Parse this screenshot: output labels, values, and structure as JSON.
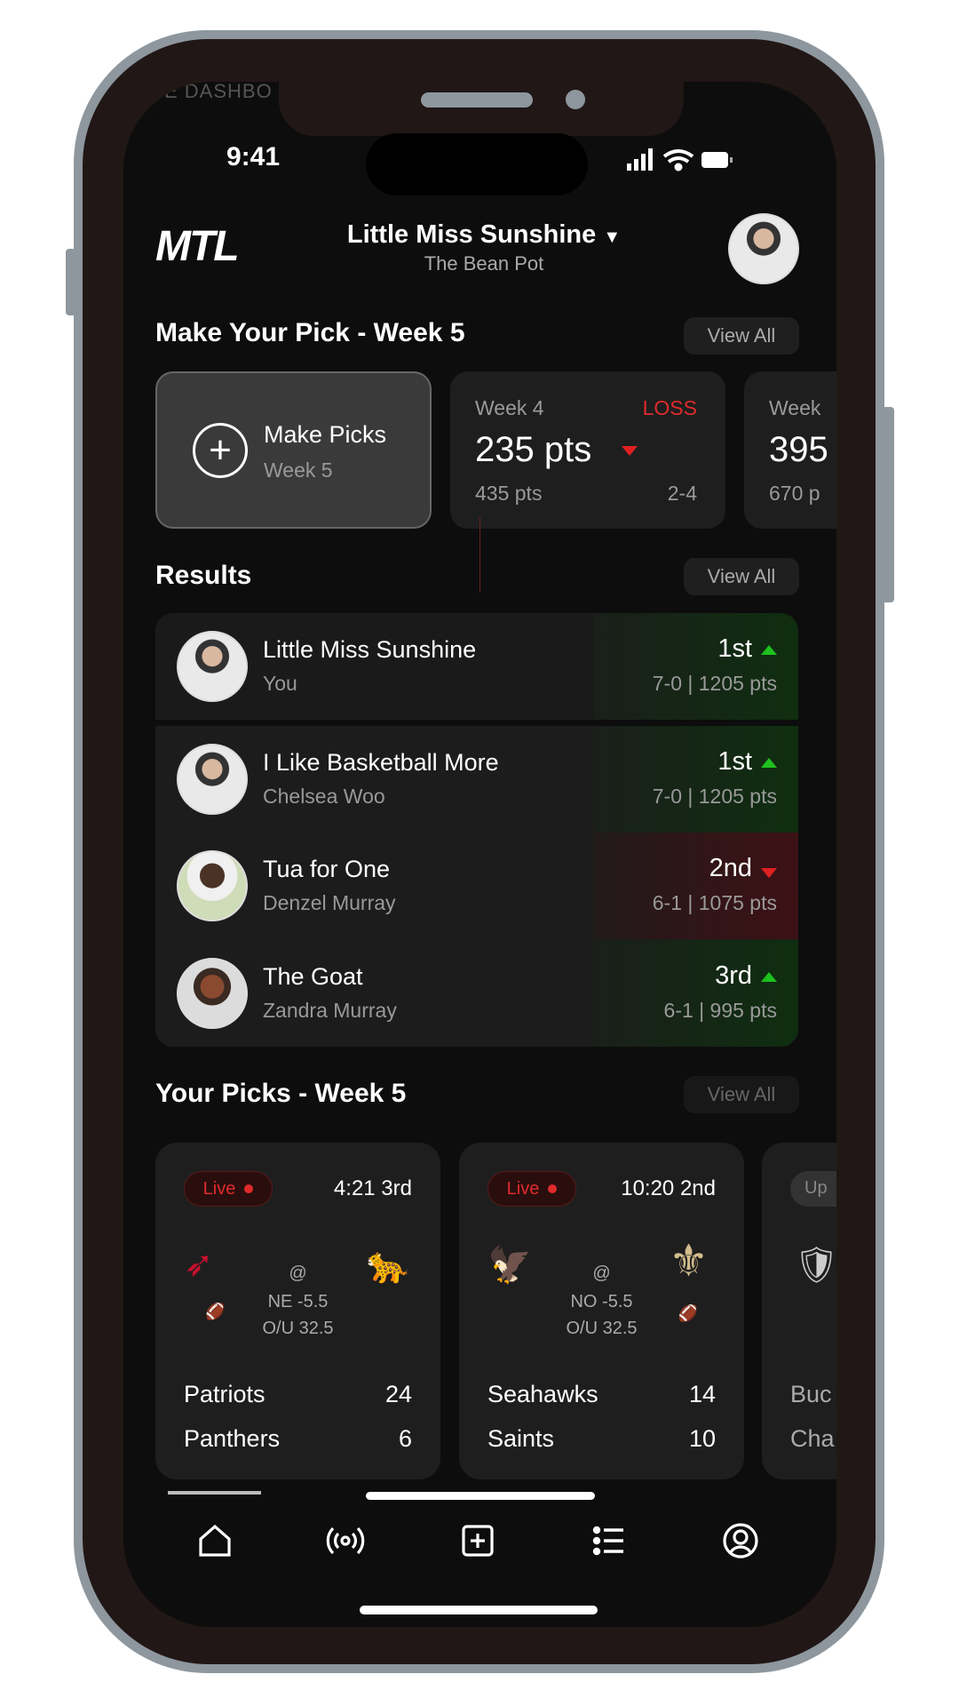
{
  "status": {
    "time": "9:41"
  },
  "ghost_text": "GUE DASHBO",
  "header": {
    "logo": "MTL",
    "team_name": "Little Miss Sunshine",
    "league": "The Bean Pot"
  },
  "make_pick": {
    "title": "Make Your Pick - Week 5",
    "view_all": "View All",
    "cta": {
      "label": "Make Picks",
      "sub": "Week 5"
    },
    "weeks": [
      {
        "week": "Week 4",
        "result": "LOSS",
        "points": "235 pts",
        "trend": "down",
        "total": "435 pts",
        "record": "2-4"
      },
      {
        "week": "Week",
        "points": "395",
        "total": "670 p"
      }
    ]
  },
  "results": {
    "title": "Results",
    "view_all": "View All",
    "rows": [
      {
        "name": "Little Miss Sunshine",
        "owner": "You",
        "place": "1st",
        "trend": "up",
        "record": "7-0 | 1205 pts"
      },
      {
        "name": "I Like Basketball More",
        "owner": "Chelsea Woo",
        "place": "1st",
        "trend": "up",
        "record": "7-0 | 1205 pts"
      },
      {
        "name": "Tua for One",
        "owner": "Denzel Murray",
        "place": "2nd",
        "trend": "down",
        "record": "6-1 | 1075 pts"
      },
      {
        "name": "The Goat",
        "owner": "Zandra Murray",
        "place": "3rd",
        "trend": "up",
        "record": "6-1 | 995 pts"
      }
    ]
  },
  "picks": {
    "title": "Your Picks - Week 5",
    "view_all": "View All",
    "games": [
      {
        "status": "Live",
        "clock": "4:21 3rd",
        "at": "@",
        "spread": "NE -5.5",
        "ou": "O/U 32.5",
        "home": "Patriots",
        "home_score": "24",
        "away": "Panthers",
        "away_score": "6"
      },
      {
        "status": "Live",
        "clock": "10:20 2nd",
        "at": "@",
        "spread": "NO -5.5",
        "ou": "O/U 32.5",
        "home": "Seahawks",
        "home_score": "14",
        "away": "Saints",
        "away_score": "10"
      },
      {
        "status": "Up",
        "home": "Buc",
        "away": "Cha"
      }
    ]
  },
  "nav": {
    "items": [
      "home-icon",
      "live-broadcast-icon",
      "add-square-icon",
      "list-icon",
      "profile-icon"
    ],
    "active": "home-icon"
  },
  "colors": {
    "win": "#1ec01e",
    "loss": "#e02020",
    "background": "#0d0d0d",
    "card": "#1e1e1e"
  }
}
